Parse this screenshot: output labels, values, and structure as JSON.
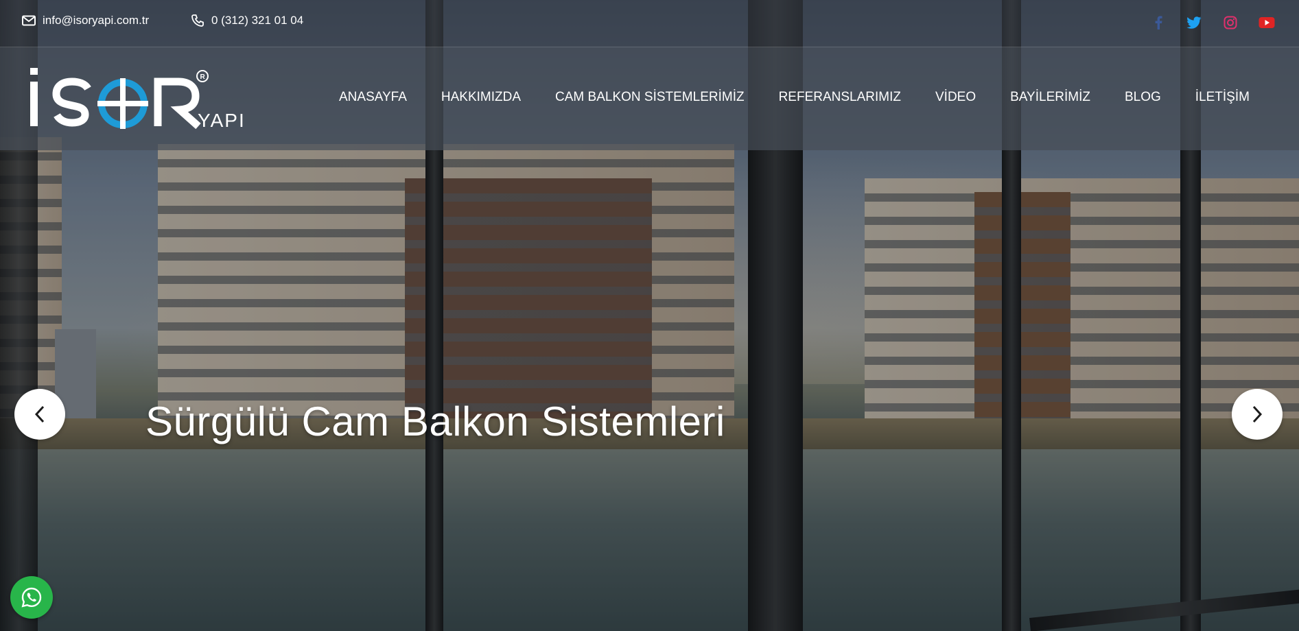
{
  "topbar": {
    "email": "info@isoryapi.com.tr",
    "phone": "0 (312) 321 01 04",
    "email_icon": "envelope-icon",
    "phone_icon": "phone-icon",
    "social": [
      {
        "name": "facebook-icon",
        "color": "#3b5998"
      },
      {
        "name": "twitter-icon",
        "color": "#1da1f2"
      },
      {
        "name": "instagram-icon",
        "color": "#e1306c"
      },
      {
        "name": "youtube-icon",
        "color": "#e02424"
      }
    ]
  },
  "brand": {
    "logo_main": "İSOR",
    "logo_sub": "YAPI",
    "logo_mark": "R",
    "accent": "#1e9bd7"
  },
  "nav": {
    "items": [
      {
        "label": "ANASAYFA"
      },
      {
        "label": "HAKKIMIZDA"
      },
      {
        "label": "CAM BALKON SİSTEMLERİMİZ"
      },
      {
        "label": "REFERANSLARIMIZ"
      },
      {
        "label": "VİDEO"
      },
      {
        "label": "BAYİLERİMİZ"
      },
      {
        "label": "BLOG"
      },
      {
        "label": "İLETİŞİM"
      }
    ]
  },
  "slider": {
    "title": "Sürgülü Cam Balkon Sistemleri",
    "prev_icon": "chevron-left-icon",
    "next_icon": "chevron-right-icon"
  },
  "whatsapp": {
    "icon": "whatsapp-icon",
    "color": "#28b54a"
  }
}
